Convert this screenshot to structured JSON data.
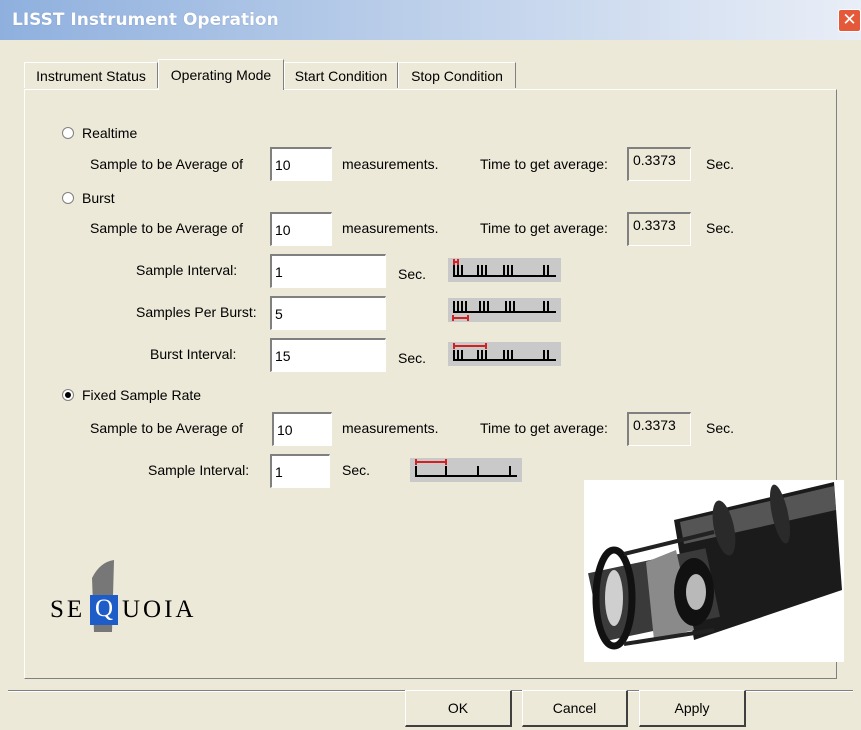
{
  "window": {
    "title": "LISST Instrument Operation",
    "close_glyph": "✕"
  },
  "tabs": [
    "Instrument Status",
    "Operating Mode",
    "Start Condition",
    "Stop Condition"
  ],
  "active_tab": "Operating Mode",
  "modes": {
    "selected": "Fixed Sample Rate",
    "realtime": {
      "label": "Realtime",
      "avg_label": "Sample to be Average of",
      "avg_value": "10",
      "measurements_label": "measurements.",
      "time_label": "Time to get average:",
      "time_value": "0.3373",
      "sec_label": "Sec."
    },
    "burst": {
      "label": "Burst",
      "avg_label": "Sample to be Average of",
      "avg_value": "10",
      "measurements_label": "measurements.",
      "time_label": "Time to get average:",
      "time_value": "0.3373",
      "sec_label": "Sec.",
      "sample_interval_label": "Sample Interval:",
      "sample_interval_value": "1",
      "sample_interval_unit": "Sec.",
      "samples_per_burst_label": "Samples Per Burst:",
      "samples_per_burst_value": "5",
      "burst_interval_label": "Burst Interval:",
      "burst_interval_value": "15",
      "burst_interval_unit": "Sec."
    },
    "fixed": {
      "label": "Fixed Sample Rate",
      "avg_label": "Sample to be Average of",
      "avg_value": "10",
      "measurements_label": "measurements.",
      "time_label": "Time to get average:",
      "time_value": "0.3373",
      "sec_label": "Sec.",
      "sample_interval_label": "Sample Interval:",
      "sample_interval_value": "1",
      "sample_interval_unit": "Sec."
    }
  },
  "logo": {
    "text_left": "SE",
    "text_letter": "Q",
    "text_right": "UOIA"
  },
  "buttons": {
    "ok": "OK",
    "cancel": "Cancel",
    "apply": "Apply"
  },
  "colors": {
    "accent_red": "#d42020",
    "logo_box": "#1e5cc8",
    "title_gradient_start": "#8fb0de",
    "close_red": "#e5593b"
  }
}
